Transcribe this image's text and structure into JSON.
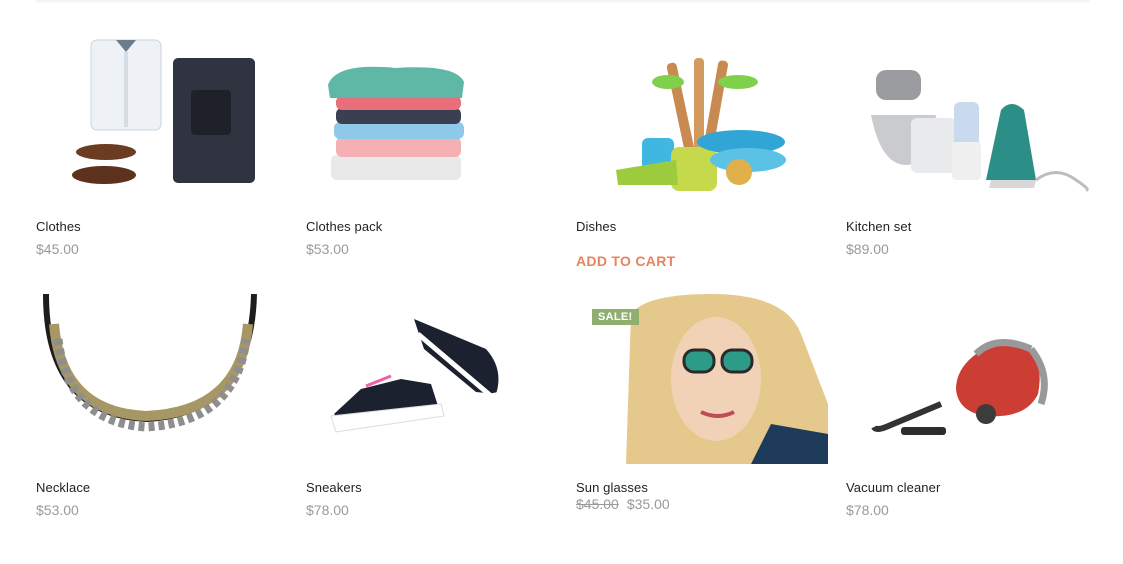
{
  "products": [
    {
      "name": "Clothes",
      "price": "$45.00",
      "image_icon": "clothes-image"
    },
    {
      "name": "Clothes pack",
      "price": "$53.00",
      "image_icon": "clothes-pack-image"
    },
    {
      "name": "Dishes",
      "action": "ADD TO CART",
      "image_icon": "dishes-image"
    },
    {
      "name": "Kitchen set",
      "price": "$89.00",
      "image_icon": "kitchen-set-image"
    },
    {
      "name": "Necklace",
      "price": "$53.00",
      "image_icon": "necklace-image"
    },
    {
      "name": "Sneakers",
      "price": "$78.00",
      "image_icon": "sneakers-image"
    },
    {
      "name": "Sun glasses",
      "old_price": "$45.00",
      "price": "$35.00",
      "badge": "SALE!",
      "image_icon": "sunglasses-image"
    },
    {
      "name": "Vacuum cleaner",
      "price": "$78.00",
      "image_icon": "vacuum-cleaner-image"
    }
  ],
  "colors": {
    "add_to_cart": "#e8835f",
    "sale_badge": "#8fae6f",
    "price": "#9a9a9a"
  }
}
